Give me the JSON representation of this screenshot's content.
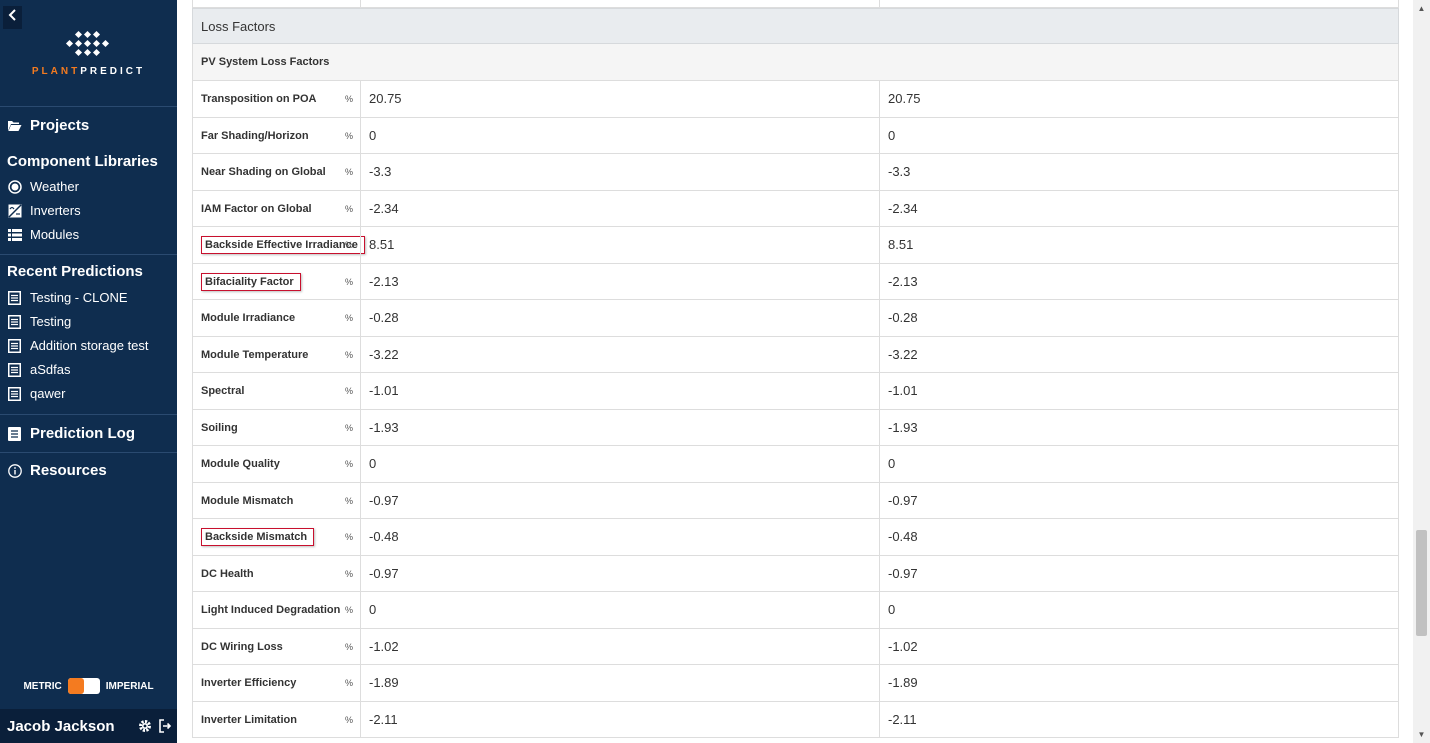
{
  "sidebar": {
    "logo": {
      "part1": "PLANT",
      "part2": "PREDICT"
    },
    "projects_label": "Projects",
    "component_libraries_label": "Component Libraries",
    "libraries": [
      {
        "label": "Weather",
        "icon": "weather-icon"
      },
      {
        "label": "Inverters",
        "icon": "inverter-icon"
      },
      {
        "label": "Modules",
        "icon": "modules-icon"
      }
    ],
    "recent_predictions_label": "Recent Predictions",
    "recent": [
      {
        "label": "Testing - CLONE"
      },
      {
        "label": "Testing"
      },
      {
        "label": "Addition storage test"
      },
      {
        "label": "aSdfas"
      },
      {
        "label": "qawer"
      }
    ],
    "prediction_log_label": "Prediction Log",
    "resources_label": "Resources",
    "units": {
      "metric": "METRIC",
      "imperial": "IMPERIAL",
      "selected": "METRIC"
    },
    "user_name": "Jacob Jackson"
  },
  "colors": {
    "sidebar_bg": "#0f2d4f",
    "accent": "#f47b20",
    "highlight_border": "#c8102e"
  },
  "table": {
    "section_title": "Loss Factors",
    "subsection_title": "PV System Loss Factors",
    "rows": [
      {
        "label": "Transposition on POA",
        "unit": "%",
        "col1": "20.75",
        "col2": "20.75",
        "highlighted": false
      },
      {
        "label": "Far Shading/Horizon",
        "unit": "%",
        "col1": "0",
        "col2": "0",
        "highlighted": false
      },
      {
        "label": "Near Shading on Global",
        "unit": "%",
        "col1": "-3.3",
        "col2": "-3.3",
        "highlighted": false
      },
      {
        "label": "IAM Factor on Global",
        "unit": "%",
        "col1": "-2.34",
        "col2": "-2.34",
        "highlighted": false
      },
      {
        "label": "Backside Effective Irradiance",
        "unit": "%",
        "col1": "8.51",
        "col2": "8.51",
        "highlighted": true
      },
      {
        "label": "Bifaciality Factor",
        "unit": "%",
        "col1": "-2.13",
        "col2": "-2.13",
        "highlighted": true
      },
      {
        "label": "Module Irradiance",
        "unit": "%",
        "col1": "-0.28",
        "col2": "-0.28",
        "highlighted": false
      },
      {
        "label": "Module Temperature",
        "unit": "%",
        "col1": "-3.22",
        "col2": "-3.22",
        "highlighted": false
      },
      {
        "label": "Spectral",
        "unit": "%",
        "col1": "-1.01",
        "col2": "-1.01",
        "highlighted": false
      },
      {
        "label": "Soiling",
        "unit": "%",
        "col1": "-1.93",
        "col2": "-1.93",
        "highlighted": false
      },
      {
        "label": "Module Quality",
        "unit": "%",
        "col1": "0",
        "col2": "0",
        "highlighted": false
      },
      {
        "label": "Module Mismatch",
        "unit": "%",
        "col1": "-0.97",
        "col2": "-0.97",
        "highlighted": false
      },
      {
        "label": "Backside Mismatch",
        "unit": "%",
        "col1": "-0.48",
        "col2": "-0.48",
        "highlighted": true
      },
      {
        "label": "DC Health",
        "unit": "%",
        "col1": "-0.97",
        "col2": "-0.97",
        "highlighted": false
      },
      {
        "label": "Light Induced Degradation",
        "unit": "%",
        "col1": "0",
        "col2": "0",
        "highlighted": false
      },
      {
        "label": "DC Wiring Loss",
        "unit": "%",
        "col1": "-1.02",
        "col2": "-1.02",
        "highlighted": false
      },
      {
        "label": "Inverter Efficiency",
        "unit": "%",
        "col1": "-1.89",
        "col2": "-1.89",
        "highlighted": false
      },
      {
        "label": "Inverter Limitation",
        "unit": "%",
        "col1": "-2.11",
        "col2": "-2.11",
        "highlighted": false
      }
    ]
  }
}
